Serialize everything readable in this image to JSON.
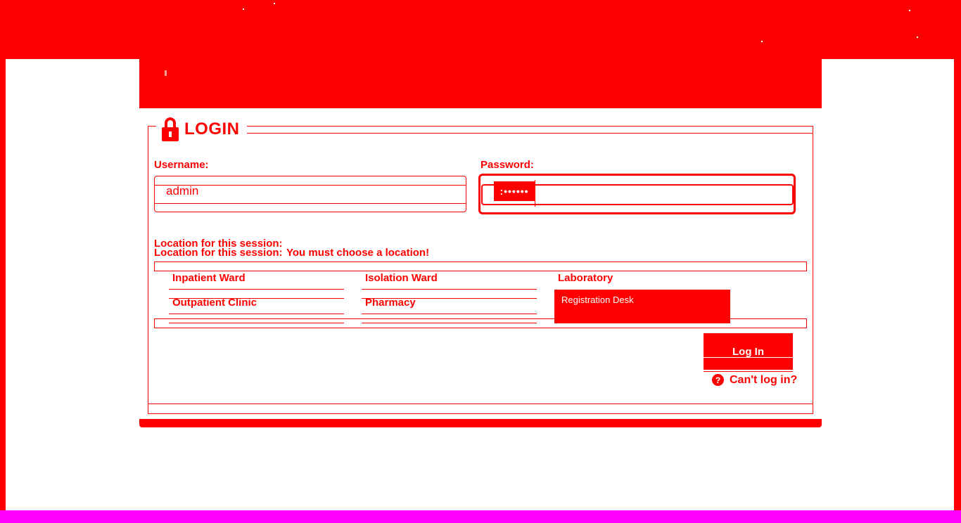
{
  "colors": {
    "accent": "#ff0000",
    "background": "#ffffff",
    "bottom_strip": "#ff00ff"
  },
  "login": {
    "legend": "LOGIN",
    "username": {
      "label": "Username:",
      "value": "admin"
    },
    "password": {
      "label": "Password:",
      "value": ":••••••"
    },
    "location": {
      "label": "Location for this session:",
      "error": "You must choose a location!",
      "options": [
        "Inpatient Ward",
        "Isolation Ward",
        "Laboratory",
        "Outpatient Clinic",
        "Pharmacy",
        "Registration Desk"
      ]
    },
    "submit_label": "Log In",
    "help_link": "Can't log in?",
    "help_icon": "?"
  }
}
